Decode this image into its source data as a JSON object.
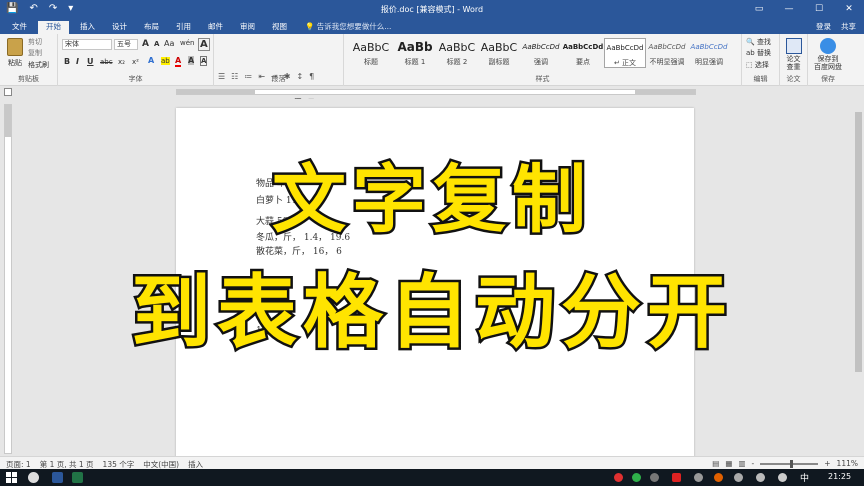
{
  "titlebar": {
    "title": "报价.doc [兼容模式] - Word",
    "qat": {
      "save": "💾",
      "undo": "↶",
      "redo": "↷",
      "customize": "▾"
    },
    "window_buttons": {
      "ribbon_display": "▭",
      "minimize": "—",
      "maximize": "☐",
      "close": "✕"
    }
  },
  "tabs": [
    {
      "label": "文件"
    },
    {
      "label": "开始"
    },
    {
      "label": "插入"
    },
    {
      "label": "设计"
    },
    {
      "label": "布局"
    },
    {
      "label": "引用"
    },
    {
      "label": "邮件"
    },
    {
      "label": "审阅"
    },
    {
      "label": "视图"
    }
  ],
  "active_tab": "开始",
  "tell_me": "💡 告诉我您想要做什么...",
  "account": {
    "login": "登录",
    "share": "共享"
  },
  "ribbon": {
    "clipboard": {
      "paste": "粘贴",
      "cut": "剪切",
      "copy": "复制",
      "format_painter": "格式刷",
      "label": "剪贴板"
    },
    "font": {
      "font_name": "宋体",
      "font_size": "五号",
      "grow": "A",
      "shrink": "A",
      "clear": "Aa",
      "wen": "wén",
      "big_a": "A",
      "bold": "B",
      "italic": "I",
      "underline": "U",
      "strike": "abc",
      "sub": "x₂",
      "sup": "x²",
      "effects": "A",
      "highlight": "ab",
      "color": "A",
      "char_shade": "A",
      "char_border": "A",
      "label": "字体"
    },
    "paragraph": {
      "row1": [
        "☰",
        "☷",
        "≔",
        "⇤",
        "⇥",
        "✱",
        "↕",
        "¶"
      ],
      "row2": [
        "≡",
        "≡",
        "≡",
        "≡",
        "≣",
        "↨",
        "▦",
        "⊞"
      ],
      "label": "段落"
    },
    "styles": {
      "tiles": [
        {
          "sample": "AaBbC",
          "name": "标题"
        },
        {
          "sample": "AaBb",
          "name": "标题 1"
        },
        {
          "sample": "AaBbC",
          "name": "标题 2"
        },
        {
          "sample": "AaBbC",
          "name": "副标题"
        },
        {
          "sample": "AaBbCcDd",
          "name": "强调"
        },
        {
          "sample": "AaBbCcDd",
          "name": "要点"
        },
        {
          "sample": "AaBbCcDd",
          "name": "↵ 正文"
        },
        {
          "sample": "AaBbCcDd",
          "name": "不明显强调"
        },
        {
          "sample": "AaBbCcDd",
          "name": "明显强调"
        }
      ],
      "label": "样式"
    },
    "editing": {
      "find": "🔍 查找",
      "replace": "ab 替换",
      "select": "⬚ 选择",
      "label": "编辑"
    },
    "paper": {
      "check": "论文查重",
      "label": "论文",
      "l1": "论文",
      "l2": "查重"
    },
    "save_cloud": {
      "l1": "保存到",
      "l2": "百度网盘",
      "label": "保存"
    }
  },
  "document": {
    "lines": [
      "物品 单价",
      "白萝卜 11.5",
      "大蒜 58.1",
      "冬瓜，斤， 1.4， 19.6",
      "散花菜，斤， 16， 6",
      "",
      "",
      "",
      "1."
    ]
  },
  "overlay": {
    "line1": "文字复制",
    "line2": "到表格自动分开"
  },
  "statusbar": {
    "page": "页面: 1",
    "section": "第 1 页, 共 1 页",
    "words": "135 个字",
    "language": "中文(中国)",
    "mode": "插入",
    "zoom": "111%",
    "zoom_minus": "-",
    "zoom_plus": "+"
  },
  "taskbar": {
    "language": "中",
    "time": "21:25"
  },
  "colors": {
    "ribbon_blue": "#2b579a",
    "headline_fill": "#ffe400",
    "headline_stroke": "#111111"
  }
}
